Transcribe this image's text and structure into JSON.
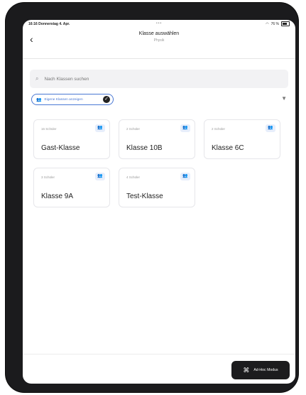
{
  "status_bar": {
    "time": "16:16  Donnerstag 4. Apr.",
    "dots": "•••",
    "battery_text": "76 %"
  },
  "header": {
    "back_icon": "chevron-left-icon",
    "title": "Klasse auswählen",
    "subtitle": "Physik"
  },
  "search": {
    "placeholder": "Nach Klassen suchen"
  },
  "filter": {
    "chip_label": "Eigene Klassen anzeigen"
  },
  "classes": [
    {
      "count": "16 Schüler",
      "name": "Gast-Klasse"
    },
    {
      "count": "2 Schüler",
      "name": "Klasse 10B"
    },
    {
      "count": "2 Schüler",
      "name": "Klasse 6C"
    },
    {
      "count": "3 Schüler",
      "name": "Klasse 9A"
    },
    {
      "count": "4 Schüler",
      "name": "Test-Klasse"
    }
  ],
  "footer": {
    "adhoc_label": "Ad-Hoc Modus"
  },
  "colors": {
    "accent": "#4a78d4",
    "dark_button": "#1c1c1e"
  }
}
